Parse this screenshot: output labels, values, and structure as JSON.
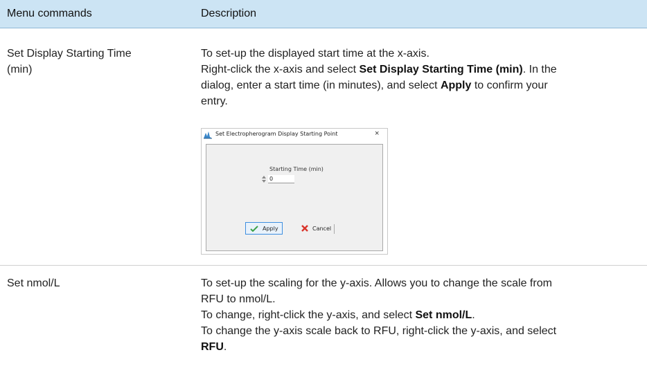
{
  "table": {
    "headers": {
      "col1": "Menu commands",
      "col2": "Description"
    },
    "rows": [
      {
        "command_lines": [
          "Set Display Starting Time",
          "(min)"
        ],
        "desc": {
          "line1": "To set-up the displayed start time at the x-axis.",
          "line2_pre": "Right-click the x-axis and select ",
          "line2_bold": "Set Display Starting Time (min)",
          "line2_post": ". In the",
          "line3": "dialog, enter a start time (in minutes), and select ",
          "line3_bold": "Apply",
          "line3_post": " to confirm your",
          "line4": "entry."
        },
        "dialog": {
          "title": "Set Electropherogram Display Starting Point",
          "close": "×",
          "field_label": "Starting Time (min)",
          "field_value": "0",
          "apply_label": "Apply",
          "cancel_label": "Cancel"
        }
      },
      {
        "command": "Set nmol/L",
        "desc": {
          "line1": "To set-up the scaling for the y-axis. Allows you to change the scale from",
          "line2": "RFU to nmol/L.",
          "line3_pre": "To change, right-click the y-axis, and select ",
          "line3_bold": "Set nmol/L",
          "line3_post": ".",
          "line4": "To change the y-axis scale back to RFU, right-click the y-axis, and select",
          "line5_bold": "RFU",
          "line5_post": "."
        }
      }
    ]
  },
  "colors": {
    "header_bg": "#cce4f4",
    "apply_border": "#3c8ee0",
    "cancel_icon": "#d9342b",
    "apply_icon": "#3ca24a"
  },
  "icons": {
    "title": "app-logo-icon",
    "apply": "check-icon",
    "cancel": "x-icon",
    "spinner": "spinner-arrows-icon"
  }
}
